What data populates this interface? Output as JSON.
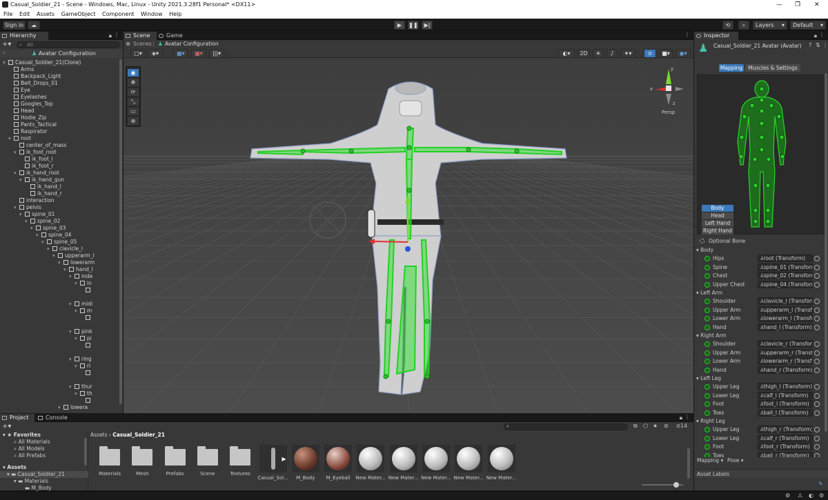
{
  "window": {
    "title": "Casual_Soldier_21 - Scene - Windows, Mac, Linux - Unity 2021.3.28f1 Personal* <DX11>",
    "min": "—",
    "max": "❐",
    "close": "✕"
  },
  "menu": [
    "File",
    "Edit",
    "Assets",
    "GameObject",
    "Component",
    "Window",
    "Help"
  ],
  "toolbar": {
    "sign_in": "Sign in",
    "layers": "Layers",
    "layout": "Default"
  },
  "hierarchy": {
    "tab": "Hierarchy",
    "search_placeholder": "All",
    "header": "Avatar Configuration",
    "rows": [
      {
        "t": "Casual_Soldier_21(Clone)",
        "d": 0,
        "a": "▾"
      },
      {
        "t": "Arms",
        "d": 1,
        "a": ""
      },
      {
        "t": "Backpack_Light",
        "d": 1,
        "a": ""
      },
      {
        "t": "Belt_Drops_01",
        "d": 1,
        "a": ""
      },
      {
        "t": "Eye",
        "d": 1,
        "a": ""
      },
      {
        "t": "Eyelashes",
        "d": 1,
        "a": ""
      },
      {
        "t": "Googles_Top",
        "d": 1,
        "a": ""
      },
      {
        "t": "Head",
        "d": 1,
        "a": ""
      },
      {
        "t": "Hodie_Zip",
        "d": 1,
        "a": ""
      },
      {
        "t": "Pants_Tactical",
        "d": 1,
        "a": ""
      },
      {
        "t": "Raspirator",
        "d": 1,
        "a": ""
      },
      {
        "t": "root",
        "d": 1,
        "a": "▾"
      },
      {
        "t": "center_of_mass",
        "d": 2,
        "a": ""
      },
      {
        "t": "ik_foot_root",
        "d": 2,
        "a": "▾"
      },
      {
        "t": "ik_foot_l",
        "d": 3,
        "a": ""
      },
      {
        "t": "ik_foot_r",
        "d": 3,
        "a": ""
      },
      {
        "t": "ik_hand_root",
        "d": 2,
        "a": "▾"
      },
      {
        "t": "ik_hand_gun",
        "d": 3,
        "a": "▾"
      },
      {
        "t": "ik_hand_l",
        "d": 4,
        "a": ""
      },
      {
        "t": "ik_hand_r",
        "d": 4,
        "a": ""
      },
      {
        "t": "interaction",
        "d": 2,
        "a": ""
      },
      {
        "t": "pelvis",
        "d": 2,
        "a": "▾"
      },
      {
        "t": "spine_01",
        "d": 3,
        "a": "▾"
      },
      {
        "t": "spine_02",
        "d": 4,
        "a": "▾"
      },
      {
        "t": "spine_03",
        "d": 5,
        "a": "▾"
      },
      {
        "t": "spine_04",
        "d": 6,
        "a": "▾"
      },
      {
        "t": "spine_05",
        "d": 7,
        "a": "▾"
      },
      {
        "t": "clavicle_l",
        "d": 8,
        "a": "▾"
      },
      {
        "t": "upperarm_l",
        "d": 9,
        "a": "▾"
      },
      {
        "t": "lowerarm",
        "d": 10,
        "a": "▾"
      },
      {
        "t": "hand_l",
        "d": 11,
        "a": "▾"
      },
      {
        "t": "inde",
        "d": 12,
        "a": "▾"
      },
      {
        "t": "in",
        "d": 13,
        "a": "▾"
      },
      {
        "t": "",
        "d": 14,
        "a": ""
      },
      {
        "t": "",
        "d": 0,
        "a": ""
      },
      {
        "t": "midi",
        "d": 12,
        "a": "▾"
      },
      {
        "t": "m",
        "d": 13,
        "a": "▾"
      },
      {
        "t": "",
        "d": 14,
        "a": ""
      },
      {
        "t": "",
        "d": 0,
        "a": ""
      },
      {
        "t": "pink",
        "d": 12,
        "a": "▾"
      },
      {
        "t": "pi",
        "d": 13,
        "a": "▾"
      },
      {
        "t": "",
        "d": 14,
        "a": ""
      },
      {
        "t": "",
        "d": 0,
        "a": ""
      },
      {
        "t": "ring",
        "d": 12,
        "a": "▾"
      },
      {
        "t": "ri",
        "d": 13,
        "a": "▾"
      },
      {
        "t": "",
        "d": 14,
        "a": ""
      },
      {
        "t": "",
        "d": 0,
        "a": ""
      },
      {
        "t": "thur",
        "d": 12,
        "a": "▾"
      },
      {
        "t": "th",
        "d": 13,
        "a": "▾"
      },
      {
        "t": "",
        "d": 14,
        "a": ""
      },
      {
        "t": "lowera",
        "d": 10,
        "a": "▾"
      }
    ]
  },
  "scene": {
    "tab_scene": "Scene",
    "tab_game": "Game",
    "breadcrumb_scenes": "Scenes",
    "breadcrumb_current": "Avatar Configuration",
    "mode_2d": "2D",
    "persp": "Persp",
    "gizmo_x": "x",
    "gizmo_y": "y",
    "gizmo_z": "z"
  },
  "inspector": {
    "tab": "Inspector",
    "title": "Casual_Soldier_21 Avatar (Avatar)",
    "tabs": [
      "Mapping",
      "Muscles & Settings"
    ],
    "body_buttons": [
      "Body",
      "Head",
      "Left Hand",
      "Right Hand"
    ],
    "optional_bone": "Optional Bone",
    "groups": [
      {
        "name": "Body",
        "bones": [
          [
            "Hips",
            "root (Transform)"
          ],
          [
            "Spine",
            "spine_01 (Transform)"
          ],
          [
            "Chest",
            "spine_02 (Transform)"
          ],
          [
            "Upper Chest",
            "spine_04 (Transform)"
          ]
        ]
      },
      {
        "name": "Left Arm",
        "bones": [
          [
            "Shoulder",
            "clavicle_l (Transform)"
          ],
          [
            "Upper Arm",
            "upperarm_l (Transform)"
          ],
          [
            "Lower Arm",
            "lowerarm_l (Transform)"
          ],
          [
            "Hand",
            "hand_l (Transform)"
          ]
        ]
      },
      {
        "name": "Right Arm",
        "bones": [
          [
            "Shoulder",
            "clavicle_r (Transform)"
          ],
          [
            "Upper Arm",
            "upperarm_r (Transform)"
          ],
          [
            "Lower Arm",
            "lowerarm_r (Transform)"
          ],
          [
            "Hand",
            "hand_r (Transform)"
          ]
        ]
      },
      {
        "name": "Left Leg",
        "bones": [
          [
            "Upper Leg",
            "thigh_l (Transform)"
          ],
          [
            "Lower Leg",
            "calf_l (Transform)"
          ],
          [
            "Foot",
            "foot_l (Transform)"
          ],
          [
            "Toes",
            "ball_l (Transform)"
          ]
        ]
      },
      {
        "name": "Right Leg",
        "bones": [
          [
            "Upper Leg",
            "thigh_r (Transform)"
          ],
          [
            "Lower Leg",
            "calf_r (Transform)"
          ],
          [
            "Foot",
            "foot_r (Transform)"
          ],
          [
            "Toes",
            "ball_r (Transform)"
          ]
        ]
      }
    ],
    "mapping_dropdown": "Mapping",
    "pose_dropdown": "Pose",
    "asset_labels": "Asset Labels"
  },
  "project": {
    "tab_project": "Project",
    "tab_console": "Console",
    "favorites": "Favorites",
    "fav_items": [
      "All Materials",
      "All Models",
      "All Prefabs"
    ],
    "assets": "Assets",
    "tree": [
      "Casual_Soldier_21",
      "Materials",
      "M_Body"
    ],
    "breadcrumb": [
      "Assets",
      "Casual_Soldier_21"
    ],
    "hidden_count": "14",
    "items": [
      {
        "name": "Materials",
        "kind": "folder"
      },
      {
        "name": "Mesh",
        "kind": "folder"
      },
      {
        "name": "Prefabs",
        "kind": "folder"
      },
      {
        "name": "Scene",
        "kind": "folder"
      },
      {
        "name": "Textures",
        "kind": "folder"
      },
      {
        "name": "Casual_Sol...",
        "kind": "model"
      },
      {
        "name": "M_Body",
        "kind": "mat-body"
      },
      {
        "name": "M_Eyeball",
        "kind": "mat-eye"
      },
      {
        "name": "New Mater...",
        "kind": "mat"
      },
      {
        "name": "New Mater...",
        "kind": "mat"
      },
      {
        "name": "New Mater...",
        "kind": "mat"
      },
      {
        "name": "New Mater...",
        "kind": "mat"
      },
      {
        "name": "New Mater...",
        "kind": "mat"
      }
    ]
  },
  "colors": {
    "accent": "#3a79bb",
    "bone_green": "#29c429",
    "panel": "#383838"
  }
}
